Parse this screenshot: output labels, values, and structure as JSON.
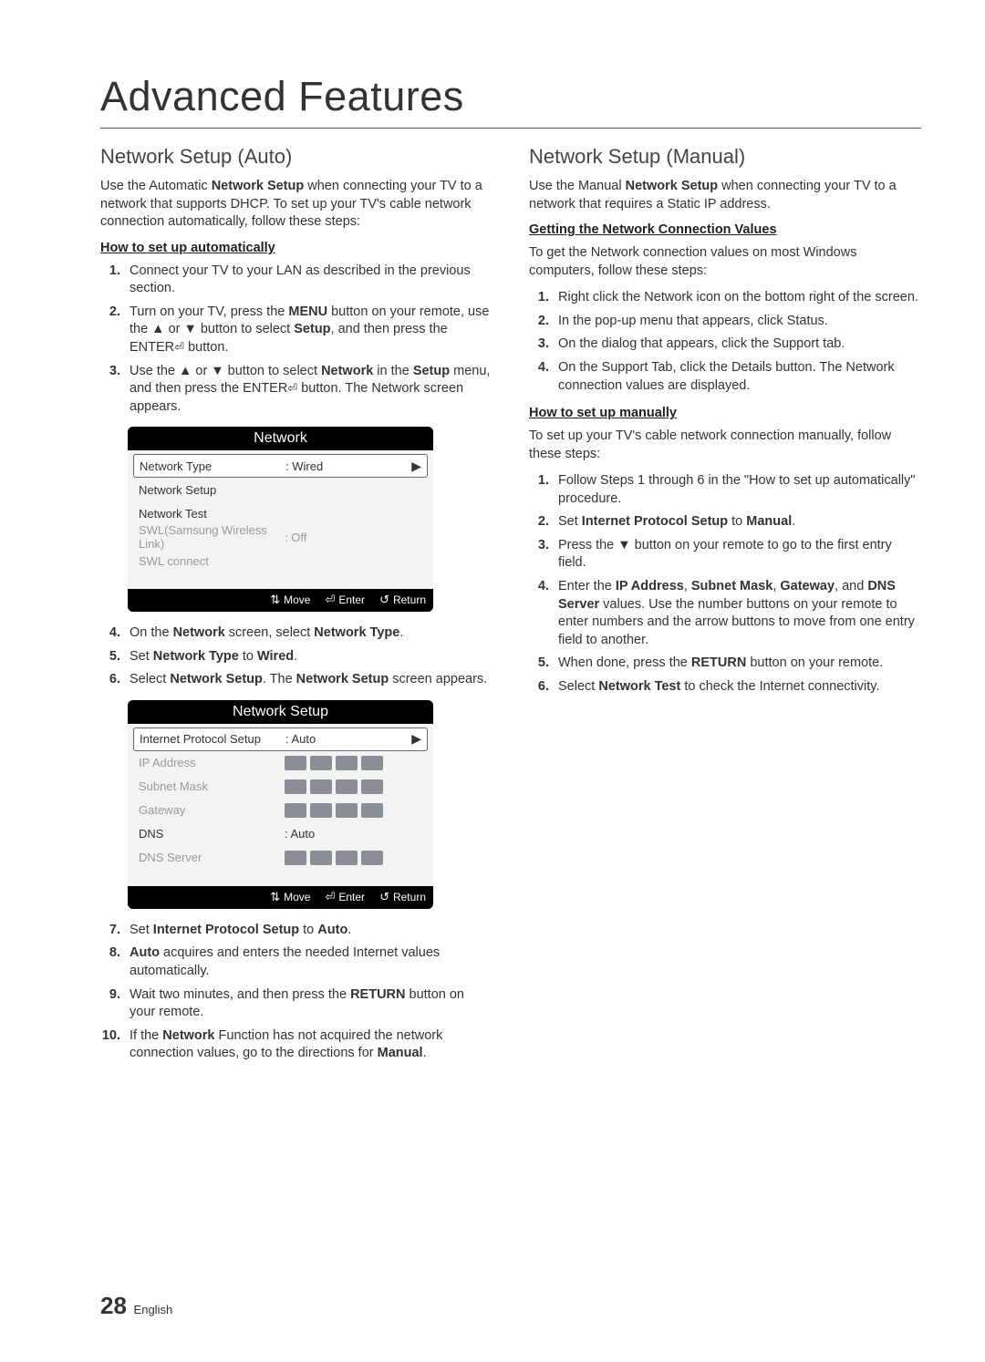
{
  "page_title": "Advanced Features",
  "footer": {
    "page_number": "28",
    "lang": "English"
  },
  "left": {
    "heading": "Network Setup (Auto)",
    "intro_pre": "Use the Automatic ",
    "intro_bold": "Network Setup",
    "intro_post": " when connecting your TV to a network that supports DHCP. To set up your TV's cable network connection automatically, follow these steps:",
    "sub1": "How to set up automatically",
    "steps1": {
      "s1": "Connect your TV to your LAN as described in the previous section.",
      "s2_a": "Turn on your TV, press the ",
      "s2_b": "MENU",
      "s2_c": " button on your remote, use the ▲ or ▼ button to select ",
      "s2_d": "Setup",
      "s2_e": ", and then press the ENTER",
      "s2_f": " button.",
      "s3_a": "Use the ▲ or ▼ button to select ",
      "s3_b": "Network",
      "s3_c": " in the ",
      "s3_d": "Setup",
      "s3_e": " menu, and then press the ENTER",
      "s3_f": " button. The Network screen appears."
    },
    "osd1": {
      "title": "Network",
      "r1_label": "Network Type",
      "r1_val": ": Wired",
      "r2_label": "Network Setup",
      "r3_label": "Network Test",
      "r4_label": "SWL(Samsung Wireless Link)",
      "r4_val": ": Off",
      "r5_label": "SWL connect",
      "foot_move": "Move",
      "foot_enter": "Enter",
      "foot_return": "Return"
    },
    "steps2": {
      "s4_a": "On the ",
      "s4_b": "Network",
      "s4_c": " screen, select ",
      "s4_d": "Network Type",
      "s4_e": ".",
      "s5_a": "Set ",
      "s5_b": "Network Type",
      "s5_c": " to ",
      "s5_d": "Wired",
      "s5_e": ".",
      "s6_a": "Select ",
      "s6_b": "Network Setup",
      "s6_c": ". The ",
      "s6_d": "Network Setup",
      "s6_e": " screen appears."
    },
    "osd2": {
      "title": "Network Setup",
      "r1_label": "Internet Protocol Setup",
      "r1_val": ": Auto",
      "r2_label": "IP Address",
      "r3_label": "Subnet Mask",
      "r4_label": "Gateway",
      "r5_label": "DNS",
      "r5_val": ": Auto",
      "r6_label": "DNS Server",
      "foot_move": "Move",
      "foot_enter": "Enter",
      "foot_return": "Return"
    },
    "steps3": {
      "s7_a": "Set ",
      "s7_b": "Internet Protocol Setup",
      "s7_c": " to ",
      "s7_d": "Auto",
      "s7_e": ".",
      "s8_a": "",
      "s8_b": "Auto",
      "s8_c": " acquires and enters the needed Internet values automatically.",
      "s9_a": "Wait two minutes, and then press the ",
      "s9_b": "RETURN",
      "s9_c": " button on your remote.",
      "s10_a": "If the ",
      "s10_b": "Network",
      "s10_c": " Function has not acquired the network connection values, go to the directions for ",
      "s10_d": "Manual",
      "s10_e": "."
    }
  },
  "right": {
    "heading": "Network Setup (Manual)",
    "intro_pre": "Use the Manual ",
    "intro_bold": "Network Setup",
    "intro_post": " when connecting your TV to a network that requires a Static IP address.",
    "sub1": "Getting the Network Connection Values",
    "p1": "To get the Network connection values on most Windows computers, follow these steps:",
    "stepsA": {
      "s1": "Right click the Network icon on the bottom right of the screen.",
      "s2": "In the pop-up menu that appears, click Status.",
      "s3": "On the dialog that appears, click the Support tab.",
      "s4": "On the Support Tab, click the Details button. The Network connection values are displayed."
    },
    "sub2": "How to set up manually",
    "p2": "To set up your TV's cable network connection manually, follow these steps:",
    "stepsB": {
      "s1": "Follow Steps 1 through 6 in the \"How to set up automatically\" procedure.",
      "s2_a": "Set ",
      "s2_b": "Internet Protocol Setup",
      "s2_c": " to ",
      "s2_d": "Manual",
      "s2_e": ".",
      "s3": "Press the ▼ button on your remote to go to the first entry field.",
      "s4_a": "Enter the ",
      "s4_b": "IP Address",
      "s4_c": ", ",
      "s4_d": "Subnet Mask",
      "s4_e": ", ",
      "s4_f": "Gateway",
      "s4_g": ", and ",
      "s4_h": "DNS Server",
      "s4_i": " values. Use the number buttons on your remote to enter numbers and the arrow buttons to move from one entry field to another.",
      "s5_a": "When done, press the ",
      "s5_b": "RETURN",
      "s5_c": " button on your remote.",
      "s6_a": "Select ",
      "s6_b": "Network Test",
      "s6_c": " to check the Internet connectivity."
    }
  },
  "glyphs": {
    "updown": "▲▼",
    "enter": "↵",
    "return": "↺",
    "caret": "▶",
    "enter_box": "⏎"
  }
}
